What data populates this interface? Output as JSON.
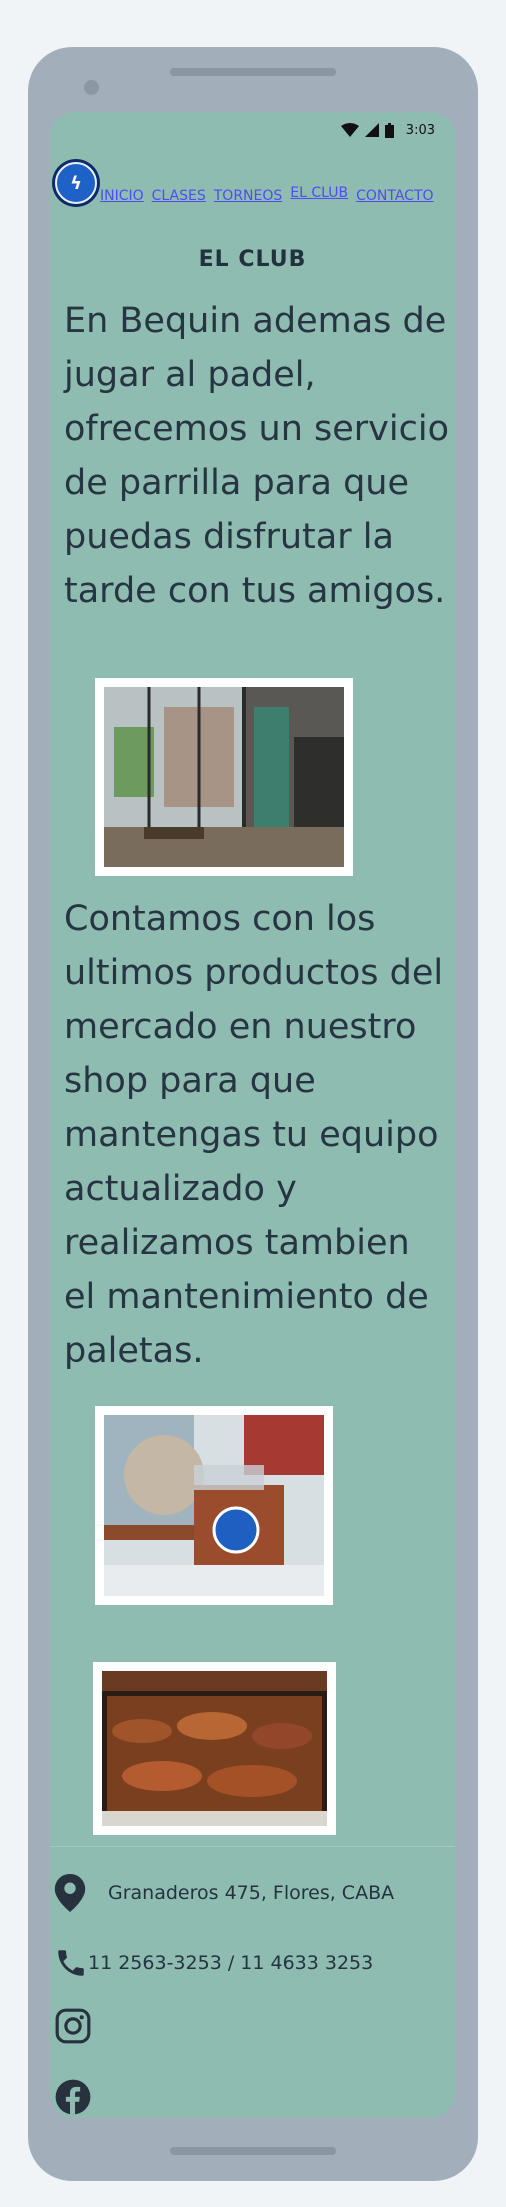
{
  "status_bar": {
    "time": "3:03"
  },
  "nav": {
    "items": [
      {
        "label": "INICIO"
      },
      {
        "label": "CLASES"
      },
      {
        "label": "TORNEOS"
      },
      {
        "label": "EL CLUB"
      },
      {
        "label": "CONTACTO"
      }
    ],
    "active": "EL CLUB"
  },
  "page": {
    "heading": "EL CLUB",
    "paragraph_1": "En Bequin ademas de jugar al padel, ofrecemos un servicio de parrilla para que puedas disfrutar la tarde con tus amigos.",
    "paragraph_2": "Contamos con los ultimos productos del mercado en nuestro shop para que mantengas tu equipo actualizado y realizamos tambien el mantenimiento de paletas."
  },
  "footer": {
    "address": "Granaderos 475, Flores, CABA",
    "phone": "11 2563-3253 / 11 4633 3253"
  },
  "colors": {
    "screen_background": "#8fbcb1",
    "text": "#273442",
    "link": "#4e4cf2",
    "logo_blue": "#1e62c7"
  },
  "icons": [
    "wifi-icon",
    "signal-icon",
    "battery-icon",
    "map-pin-icon",
    "phone-icon",
    "instagram-icon",
    "facebook-icon"
  ]
}
